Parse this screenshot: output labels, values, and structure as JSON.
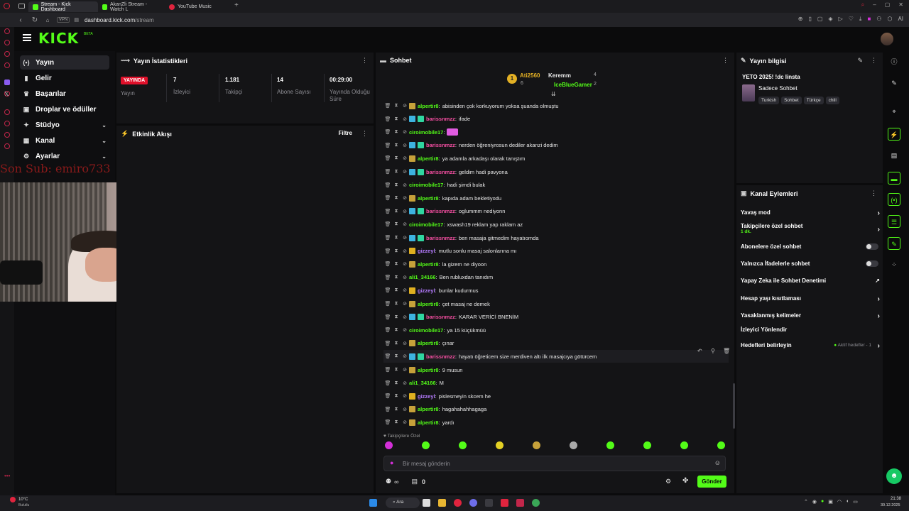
{
  "browser": {
    "tabs": [
      {
        "label": "Stream - Kick Dashboard",
        "active": true
      },
      {
        "label": "AkanZli Stream - Watch L",
        "active": false
      },
      {
        "label": "YouTube Music",
        "active": false
      }
    ],
    "vpn": "VPN",
    "url_domain": "dashboard.kick.com",
    "url_path": "/stream",
    "ai_label": "AI"
  },
  "header": {
    "logo": "KICK",
    "beta": "BETA"
  },
  "sidebar": {
    "items": [
      {
        "label": "Yayın",
        "icon": "(•)"
      },
      {
        "label": "Gelir",
        "icon": "▮"
      },
      {
        "label": "Başarılar",
        "icon": "♛"
      },
      {
        "label": "Droplar ve ödüller",
        "icon": "▣"
      },
      {
        "label": "Stüdyo",
        "icon": "✦"
      },
      {
        "label": "Kanal",
        "icon": "▦"
      },
      {
        "label": "Ayarlar",
        "icon": "⚙"
      }
    ],
    "son_sub": "Son Sub: emiro733"
  },
  "stats": {
    "title": "Yayın İstatistikleri",
    "live_badge": "YAYINDA",
    "live_label": "Yayın",
    "items": [
      {
        "value": "7",
        "label": "İzleyici"
      },
      {
        "value": "1.181",
        "label": "Takipçi"
      },
      {
        "value": "14",
        "label": "Abone Sayısı"
      },
      {
        "value": "00:29:00",
        "label": "Yayında Olduğu Süre"
      }
    ]
  },
  "activity": {
    "title": "Etkinlik Akışı",
    "filter": "Filtre"
  },
  "chat": {
    "title": "Sohbet",
    "leaderboard": {
      "rank": "1",
      "top_user": "Ati2560",
      "top_count": "6",
      "second_user": "Keremm",
      "second_count": "4",
      "third_user": "IceBlueGamer",
      "third_count": "2"
    },
    "messages": [
      {
        "user": "alpertir8",
        "text": "abisinden çok korkuyorum yoksa şuanda olmuştu",
        "color": "#53fc18",
        "badge": "#c6a13a"
      },
      {
        "user": "barissnmzz",
        "text": "ifade",
        "color": "#f74fa3",
        "badge": "#3db3e0"
      },
      {
        "user": "ciroimobile17",
        "text": "",
        "color": "#53fc18",
        "badge": "",
        "emote": "#e05ce0"
      },
      {
        "user": "barissnmzz",
        "text": "nerden öğreniyrosun dediler akanzi dedim",
        "color": "#f74fa3",
        "badge": "#3db3e0"
      },
      {
        "user": "alpertir8",
        "text": "ya adamla arkadaşı olarak tanıştım",
        "color": "#53fc18",
        "badge": "#c6a13a"
      },
      {
        "user": "barissnmzz",
        "text": "geldim hadi pavyona",
        "color": "#f74fa3",
        "badge": "#3db3e0"
      },
      {
        "user": "ciroimobile17",
        "text": "hadi şimdi bulak",
        "color": "#53fc18",
        "badge": ""
      },
      {
        "user": "alpertir8",
        "text": "kapıda adam bekletiyodu",
        "color": "#53fc18",
        "badge": "#c6a13a"
      },
      {
        "user": "barissnmzz",
        "text": "oglummm nediyonn",
        "color": "#f74fa3",
        "badge": "#3db3e0"
      },
      {
        "user": "ciroimobile17",
        "text": "xswash19 reklam yap raklam az",
        "color": "#53fc18",
        "badge": ""
      },
      {
        "user": "barissnmzz",
        "text": "ben masaja gitmedim hayatıomda",
        "color": "#f74fa3",
        "badge": "#3db3e0"
      },
      {
        "user": "gizzeyl",
        "text": "mutlu sonlu masaj salonlarına mı",
        "color": "#b57bff",
        "badge": "#e0b020"
      },
      {
        "user": "alpertir8",
        "text": "la gizem ne diyoon",
        "color": "#53fc18",
        "badge": "#c6a13a"
      },
      {
        "user": "ali1_34166",
        "text": "Ben rubluxdan tanıdım",
        "color": "#53fc18",
        "badge": ""
      },
      {
        "user": "gizzeyl",
        "text": "bunlar kudurmus",
        "color": "#b57bff",
        "badge": "#e0b020"
      },
      {
        "user": "alpertir8",
        "text": "çet masaj ne demek",
        "color": "#53fc18",
        "badge": "#c6a13a"
      },
      {
        "user": "barissnmzz",
        "text": "KARAR VERİCİ BNENİM",
        "color": "#f74fa3",
        "badge": "#3db3e0"
      },
      {
        "user": "ciroimobile17",
        "text": "ya 15 küçükmüü",
        "color": "#53fc18",
        "badge": ""
      },
      {
        "user": "alpertir8",
        "text": "çınar",
        "color": "#53fc18",
        "badge": "#c6a13a"
      },
      {
        "user": "barissnmzz",
        "text": "hayatı öğreticem size merdiven altı ilk masajcıya götürcem",
        "color": "#f74fa3",
        "badge": "#3db3e0"
      },
      {
        "user": "alpertir8",
        "text": "9 musun",
        "color": "#53fc18",
        "badge": "#c6a13a"
      },
      {
        "user": "ali1_34166",
        "text": "M",
        "color": "#53fc18",
        "badge": ""
      },
      {
        "user": "gizzeyl",
        "text": "pislesmeyin skcem he",
        "color": "#b57bff",
        "badge": "#e0b020"
      },
      {
        "user": "alpertir8",
        "text": "hagahahahhagaga",
        "color": "#53fc18",
        "badge": "#c6a13a"
      },
      {
        "user": "alpertir8",
        "text": "yardı",
        "color": "#53fc18",
        "badge": "#c6a13a"
      }
    ],
    "followers_only": "Takipçilere Özel",
    "input_placeholder": "Bir mesaj gönderin",
    "infinity": "∞",
    "counter": "0",
    "send": "Gönder"
  },
  "stream_info": {
    "title": "Yayın bilgisi",
    "stream_title": "YETO 2025! !dc linsta",
    "category": "Sadece Sohbet",
    "tags": [
      "Turkish",
      "Sohbet",
      "Türkçe",
      "chill"
    ]
  },
  "channel_actions": {
    "title": "Kanal Eylemleri",
    "items": [
      {
        "label": "Yavaş mod",
        "type": "arrow"
      },
      {
        "label": "Takipçilere özel sohbet",
        "sub": "1 dk.",
        "type": "arrow"
      },
      {
        "label": "Abonelere özel sohbet",
        "type": "toggle"
      },
      {
        "label": "Yalnızca İfadelerle sohbet",
        "type": "toggle"
      },
      {
        "label": "Yapay Zeka ile Sohbet Denetimi",
        "type": "external"
      },
      {
        "label": "Hesap yaşı kısıtlaması",
        "type": "arrow"
      },
      {
        "label": "Yasaklanmış kelimeler",
        "type": "arrow"
      },
      {
        "label": "İzleyici Yönlendir",
        "type": "none"
      },
      {
        "label": "Hedefleri belirleyin",
        "type": "arrow",
        "status": "Aktif hedefler - 1"
      }
    ]
  },
  "taskbar": {
    "weather": "10°C",
    "weather_desc": "Bulutlu",
    "search": "Ara",
    "time": "21:38",
    "date": "30.12.2025"
  },
  "colors": {
    "accent": "#53fc18",
    "live": "#e0102a",
    "panel": "#141416"
  }
}
